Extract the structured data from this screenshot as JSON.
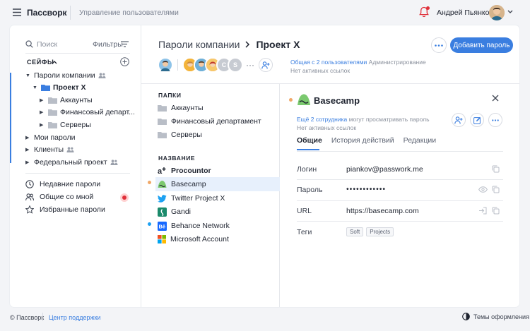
{
  "topbar": {
    "brand": "Пассворк",
    "section": "Управление пользователями",
    "user_name": "Андрей Пьянков"
  },
  "sidebar": {
    "search_placeholder": "Поиск",
    "filters_label": "Фильтры",
    "safes_header": "СЕЙФЫ",
    "tree": [
      {
        "label": "Пароли компании",
        "shared": true
      },
      {
        "label": "Проект Х",
        "active": true
      },
      {
        "label": "Аккаунты"
      },
      {
        "label": "Финансовый департ..."
      },
      {
        "label": "Серверы"
      },
      {
        "label": "Мои пароли"
      },
      {
        "label": "Клиенты",
        "shared": true
      },
      {
        "label": "Федеральный проект",
        "shared": true
      }
    ],
    "nav": [
      {
        "label": "Недавние пароли",
        "icon": "clock-icon"
      },
      {
        "label": "Общие со мной",
        "icon": "users-icon"
      },
      {
        "label": "Избранные пароли",
        "icon": "star-icon"
      }
    ]
  },
  "header": {
    "breadcrumb_parent": "Пароли компании",
    "breadcrumb_current": "Проект Х",
    "add_button": "Добавить пароль",
    "avatar_letters": [
      "C",
      "S"
    ],
    "shared_with": "Общая с 2 пользователями",
    "shared_role": "Администрирование",
    "no_links": "Нет активных ссылок"
  },
  "list": {
    "folders_header": "ПАПКИ",
    "folders": [
      "Аккаунты",
      "Финансовый департамент",
      "Серверы"
    ],
    "names_header": "НАЗВАНИЕ",
    "items": [
      {
        "name": "Procountor",
        "icon": "procountor-icon"
      },
      {
        "name": "Basecamp",
        "icon": "basecamp-icon",
        "selected": true
      },
      {
        "name": "Twitter Project X",
        "icon": "twitter-icon"
      },
      {
        "name": "Gandi",
        "icon": "gandi-icon"
      },
      {
        "name": "Behance Network",
        "icon": "behance-icon"
      },
      {
        "name": "Microsoft Account",
        "icon": "microsoft-icon"
      }
    ]
  },
  "detail": {
    "title": "Basecamp",
    "more_viewers_link": "Ещё 2 сотрудника",
    "more_viewers_text": "могут просматривать пароль",
    "no_links": "Нет активных ссылок",
    "tabs": [
      "Общие",
      "История действий",
      "Редакции"
    ],
    "fields": {
      "login_label": "Логин",
      "login_value": "piankov@passwork.me",
      "password_label": "Пароль",
      "password_value": "••••••••••••",
      "url_label": "URL",
      "url_value": "https://basecamp.com",
      "tags_label": "Теги",
      "tags": [
        "Soft",
        "Projects"
      ]
    }
  },
  "footer": {
    "copyright": "© Пассворк",
    "support": "Центр поддержки",
    "themes": "Темы оформления"
  },
  "colors": {
    "accent": "#3a7ee0",
    "notification": "#e0303a",
    "selection": "#e7f0fc"
  }
}
